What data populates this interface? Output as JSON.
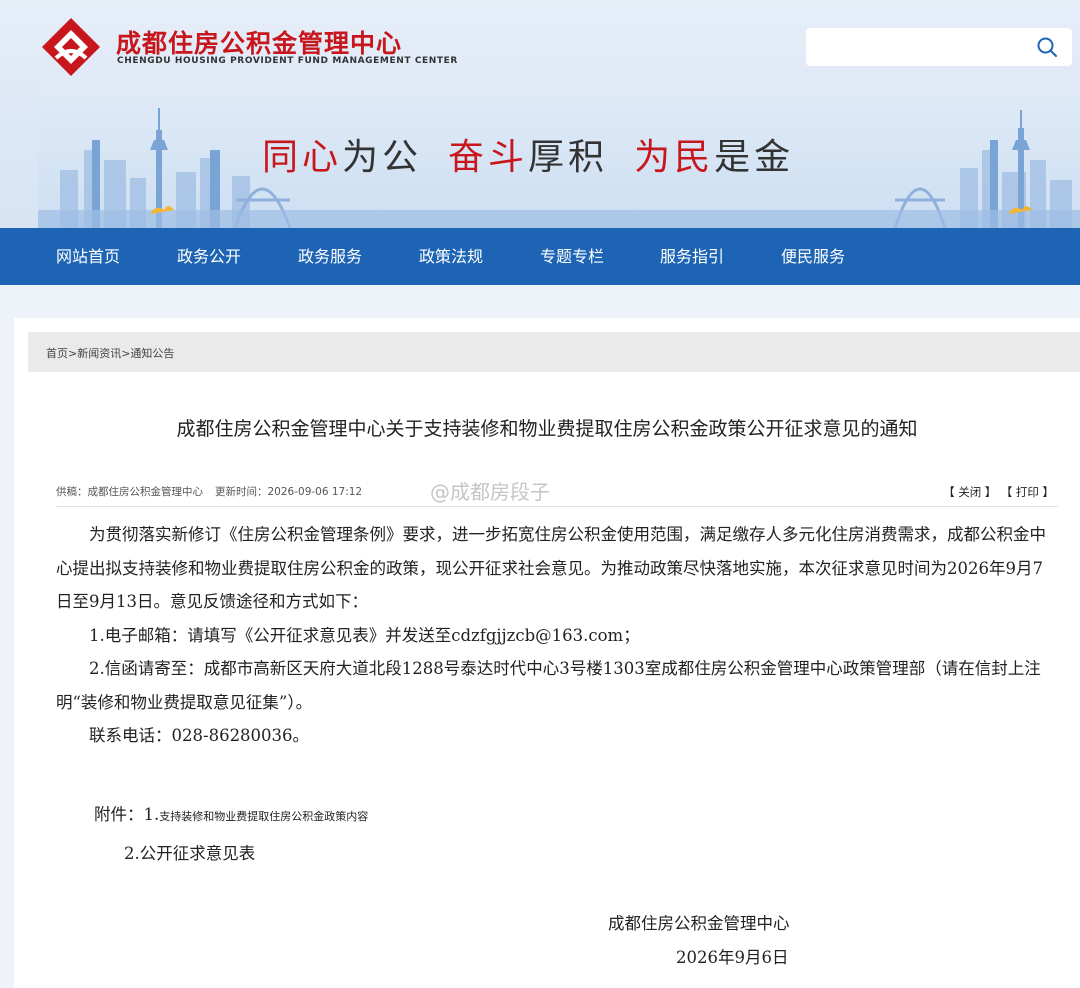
{
  "header": {
    "org_name_cn": "成都住房公积金管理中心",
    "org_name_en": "CHENGDU HOUSING PROVIDENT FUND MANAGEMENT CENTER",
    "search_placeholder": "",
    "slogan": {
      "part1_red": "同心",
      "part1_black": "为公",
      "part2_red": "奋斗",
      "part2_black": "厚积",
      "part3_red": "为民",
      "part3_black": "是金"
    },
    "brand_red": "#c8161d",
    "nav_blue": "#1d64b5"
  },
  "nav": {
    "items": [
      "网站首页",
      "政务公开",
      "政务服务",
      "政策法规",
      "专题专栏",
      "服务指引",
      "便民服务"
    ]
  },
  "article": {
    "breadcrumb": "首页>新闻资讯>通知公告",
    "title": "成都住房公积金管理中心关于支持装修和物业费提取住房公积金政策公开征求意见的通知",
    "meta_source": "供稿：成都住房公积金管理中心",
    "meta_updated": "更新时间：2026-09-06 17:12",
    "action_close": "【 关闭 】",
    "action_print": "【 打印 】",
    "watermark": "@成都房段子",
    "paragraph_intro": "为贯彻落实新修订《住房公积金管理条例》要求，进一步拓宽住房公积金使用范围，满足缴存人多元化住房消费需求，成都公积金中心提出拟支持装修和物业费提取住房公积金的政策，现公开征求社会意见。为推动政策尽快落地实施，本次征求意见时间为2026年9月7日至9月13日。意见反馈途径和方式如下：",
    "item_email": "1.电子邮箱：请填写《公开征求意见表》并发送至cdzfgjjzcb@163.com；",
    "item_mail": "2.信函请寄至：成都市高新区天府大道北段1288号泰达时代中心3号楼1303室成都住房公积金管理中心政策管理部（请在信封上注明“装修和物业费提取意见征集”）。",
    "item_phone": "联系电话：028-86280036。",
    "attach_label": "附件：",
    "attach_1_num": "1.",
    "attach_1": "支持装修和物业费提取住房公积金政策内容",
    "attach_2": "2.公开征求意见表",
    "sign_org": "成都住房公积金管理中心",
    "sign_date": "2026年9月6日"
  }
}
